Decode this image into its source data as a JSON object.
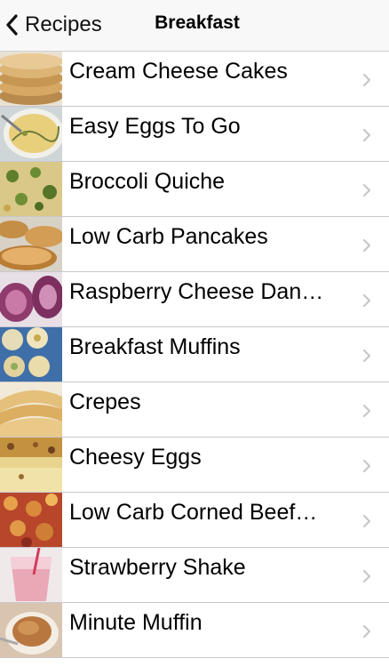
{
  "nav": {
    "back_label": "Recipes",
    "title": "Breakfast"
  },
  "recipes": [
    {
      "label": "Cream Cheese Cakes",
      "thumb": "pancake-stack"
    },
    {
      "label": "Easy Eggs To Go",
      "thumb": "whisked-eggs"
    },
    {
      "label": "Broccoli Quiche",
      "thumb": "quiche"
    },
    {
      "label": "Low Carb Pancakes",
      "thumb": "pancakes"
    },
    {
      "label": "Raspberry Cheese Dan…",
      "thumb": "danish"
    },
    {
      "label": "Breakfast Muffins",
      "thumb": "muffin-tin"
    },
    {
      "label": "Crepes",
      "thumb": "crepes"
    },
    {
      "label": "Cheesy Eggs",
      "thumb": "cheesy-eggs"
    },
    {
      "label": "Low Carb Corned Beef…",
      "thumb": "corned-beef-hash"
    },
    {
      "label": "Strawberry Shake",
      "thumb": "strawberry-shake"
    },
    {
      "label": "Minute Muffin",
      "thumb": "minute-muffin"
    }
  ],
  "colors": {
    "nav_bg": "#f8f8f8",
    "separator": "#c8c7cc",
    "chevron": "#c7c7cc"
  }
}
